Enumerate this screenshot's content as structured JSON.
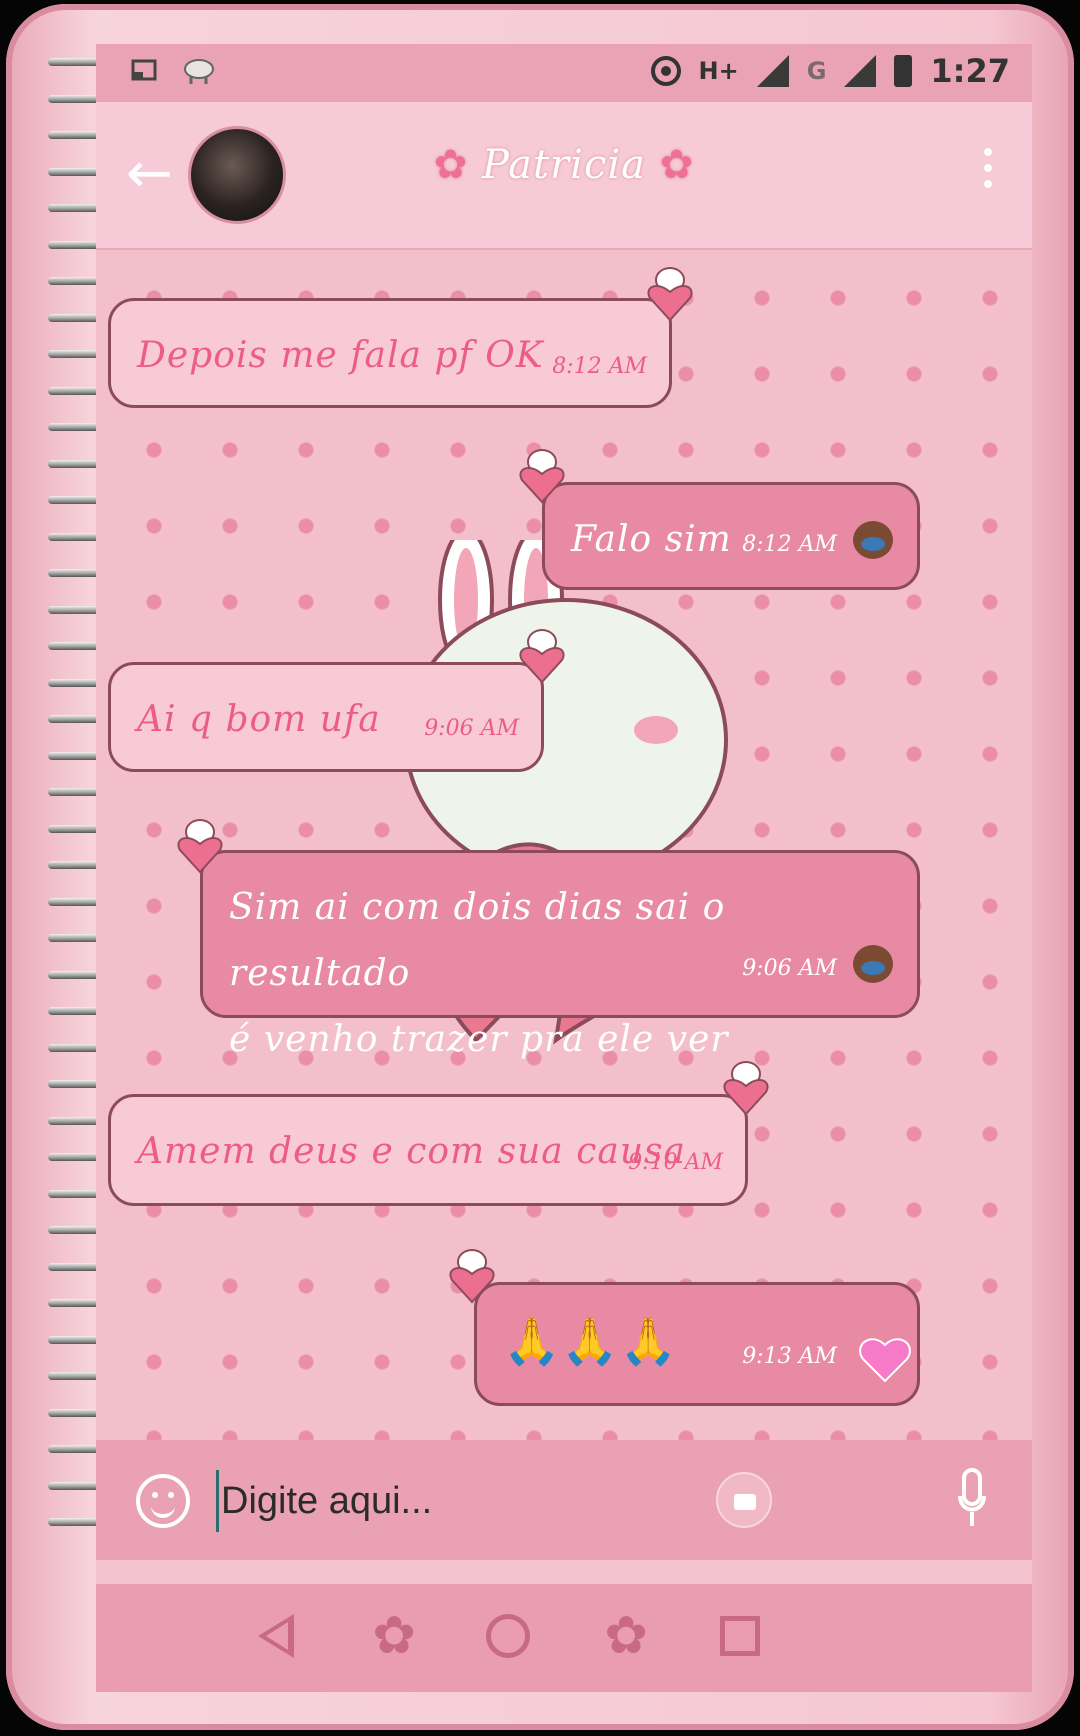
{
  "status_bar": {
    "network_type": "H+",
    "network_type_2": "G",
    "time": "1:27"
  },
  "header": {
    "contact_name": "Patricia",
    "flower_left": "✿",
    "flower_right": "✿"
  },
  "messages": [
    {
      "direction": "in",
      "text": "Depois me fala pf OK",
      "time": "8:12 AM"
    },
    {
      "direction": "out",
      "text": "Falo sim",
      "time": "8:12 AM"
    },
    {
      "direction": "in",
      "text": "Ai q bom ufa",
      "time": "9:06 AM"
    },
    {
      "direction": "out",
      "text": "Sim ai com dois dias sai o resultado\né venho trazer pra ele ver",
      "time": "9:06 AM"
    },
    {
      "direction": "in",
      "text": "Amem deus e com sua causa",
      "time": "9:10 AM"
    },
    {
      "direction": "out",
      "text": "🙏🙏🙏",
      "time": "9:13 AM"
    }
  ],
  "input": {
    "placeholder": "Digite aqui..."
  },
  "icons": {
    "back": "arrow-left",
    "menu": "more-vert",
    "emoji": "smiley",
    "camera": "camera",
    "mic": "microphone",
    "nav_back": "triangle-back",
    "nav_home": "circle-home",
    "nav_recents": "square-recents",
    "nav_flower": "flower"
  },
  "colors": {
    "accent": "#e98aa4",
    "incoming_text": "#ec5d86",
    "outgoing_bg": "#e98aa4",
    "incoming_bg": "#f7cad5"
  }
}
